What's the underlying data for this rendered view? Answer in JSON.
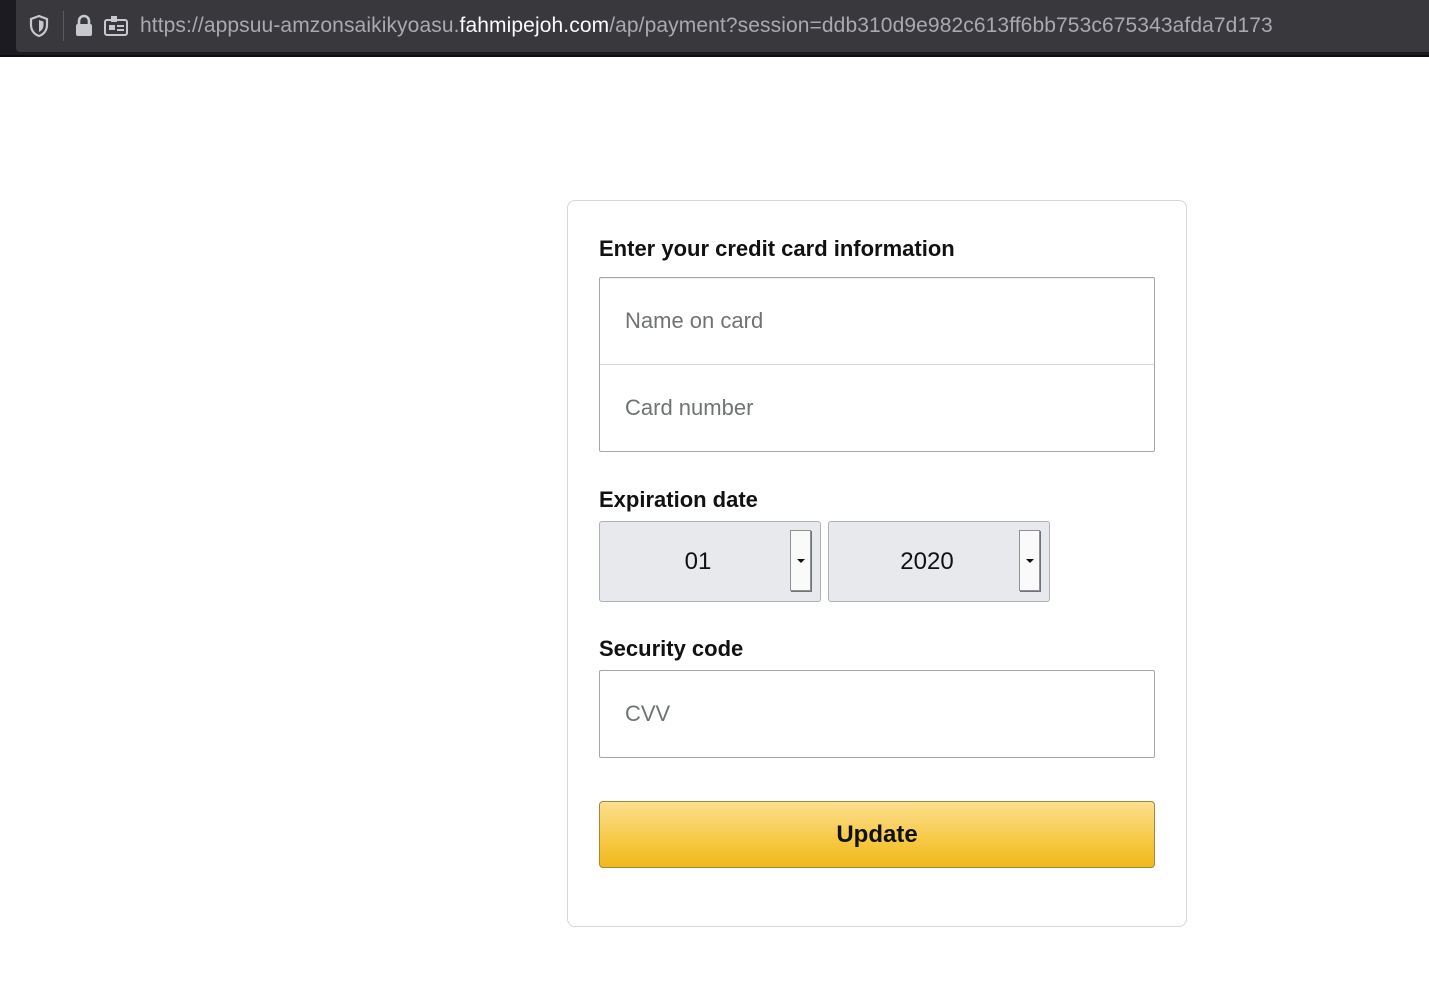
{
  "browser": {
    "url_prefix": "https://appsuu-amzonsaikikyoasu.",
    "url_host": "fahmipejoh.com",
    "url_path": "/ap/payment?session=ddb310d9e982c613ff6bb753c675343afda7d173",
    "icons": [
      "shield-icon",
      "lock-icon",
      "permissions-icon"
    ]
  },
  "form": {
    "heading": "Enter your credit card information",
    "name_placeholder": "Name on card",
    "card_placeholder": "Card number",
    "expiration_label": "Expiration date",
    "month_value": "01",
    "year_value": "2020",
    "security_label": "Security code",
    "cvv_placeholder": "CVV",
    "submit_label": "Update",
    "accent_color": "#f5c437"
  }
}
